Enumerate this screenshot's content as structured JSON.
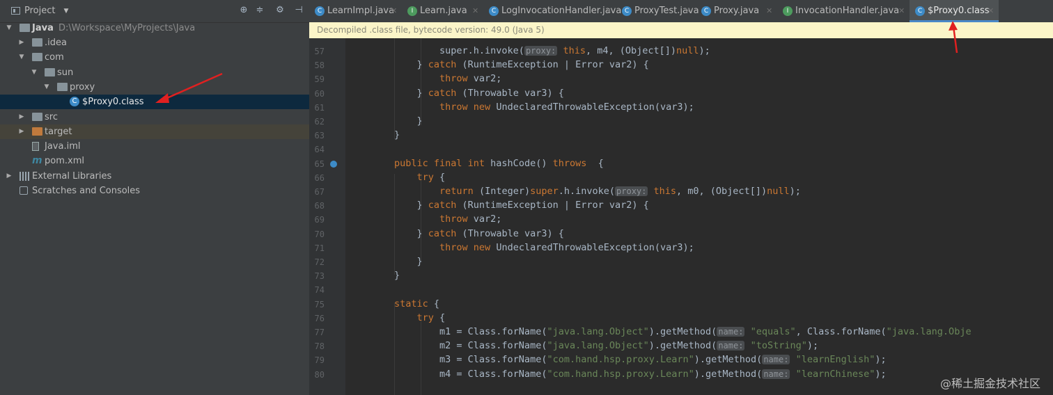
{
  "project_panel": {
    "title": "Project",
    "tree": [
      {
        "label": "Java",
        "path": "D:\\Workspace\\MyProjects\\Java",
        "level": 0,
        "expanded": true,
        "icon": "project-folder-icon"
      },
      {
        "label": ".idea",
        "level": 1,
        "expanded": false,
        "icon": "folder-icon"
      },
      {
        "label": "com",
        "level": 1,
        "expanded": true,
        "icon": "folder-icon"
      },
      {
        "label": "sun",
        "level": 2,
        "expanded": true,
        "icon": "folder-icon"
      },
      {
        "label": "proxy",
        "level": 3,
        "expanded": true,
        "icon": "folder-icon"
      },
      {
        "label": "$Proxy0.class",
        "level": 4,
        "selected": true,
        "icon": "class-file-icon"
      },
      {
        "label": "src",
        "level": 1,
        "expanded": false,
        "icon": "folder-icon"
      },
      {
        "label": "target",
        "level": 1,
        "expanded": false,
        "icon": "excluded-folder-icon"
      },
      {
        "label": "Java.iml",
        "level": 1,
        "icon": "iml-file-icon"
      },
      {
        "label": "pom.xml",
        "level": 1,
        "icon": "maven-icon"
      },
      {
        "label": "External Libraries",
        "level": 0,
        "expanded": false,
        "icon": "library-icon"
      },
      {
        "label": "Scratches and Consoles",
        "level": 0,
        "icon": "scratch-icon"
      }
    ]
  },
  "tabs": [
    {
      "label": "LearnImpl.java",
      "icon": "c"
    },
    {
      "label": "Learn.java",
      "icon": "i"
    },
    {
      "label": "LogInvocationHandler.java",
      "icon": "c"
    },
    {
      "label": "ProxyTest.java",
      "icon": "c"
    },
    {
      "label": "Proxy.java",
      "icon": "c"
    },
    {
      "label": "InvocationHandler.java",
      "icon": "i"
    },
    {
      "label": "$Proxy0.class",
      "icon": "c",
      "active": true
    }
  ],
  "tab_icon_letters": {
    "c": "C",
    "i": "I"
  },
  "banner": "Decompiled .class file, bytecode version: 49.0 (Java 5)",
  "code_lines": [
    {
      "n": "57",
      "html": "        super.h.invoke(<span class=\"hint\">proxy:</span> <span class=\"kw\">this</span>, m4, (Object[])<span class=\"kw\">null</span>);",
      "indent": 0
    },
    {
      "n": "58",
      "html": "    } <span class=\"kw\">catch</span> (RuntimeException | Error var2) {"
    },
    {
      "n": "59",
      "html": "        <span class=\"kw\">throw</span> var2;"
    },
    {
      "n": "60",
      "html": "    } <span class=\"kw\">catch</span> (Throwable var3) {"
    },
    {
      "n": "61",
      "html": "        <span class=\"kw\">throw new</span> UndeclaredThrowableException(var3);"
    },
    {
      "n": "62",
      "html": "    }"
    },
    {
      "n": "63",
      "html": "}"
    },
    {
      "n": "64",
      "html": ""
    },
    {
      "n": "65",
      "html": "<span class=\"kw\">public final int</span> hashCode() <span class=\"kw\">throws</span>  {"
    },
    {
      "n": "66",
      "html": "    <span class=\"kw\">try</span> {"
    },
    {
      "n": "67",
      "html": "        <span class=\"kw\">return</span> (Integer)<span class=\"kw\">super</span>.h.invoke(<span class=\"hint\">proxy:</span> <span class=\"kw\">this</span>, m0, (Object[])<span class=\"kw\">null</span>);"
    },
    {
      "n": "68",
      "html": "    } <span class=\"kw\">catch</span> (RuntimeException | Error var2) {"
    },
    {
      "n": "69",
      "html": "        <span class=\"kw\">throw</span> var2;"
    },
    {
      "n": "70",
      "html": "    } <span class=\"kw\">catch</span> (Throwable var3) {"
    },
    {
      "n": "71",
      "html": "        <span class=\"kw\">throw new</span> UndeclaredThrowableException(var3);"
    },
    {
      "n": "72",
      "html": "    }"
    },
    {
      "n": "73",
      "html": "}"
    },
    {
      "n": "74",
      "html": ""
    },
    {
      "n": "75",
      "html": "<span class=\"kw\">static</span> {"
    },
    {
      "n": "76",
      "html": "    <span class=\"kw\">try</span> {"
    },
    {
      "n": "77",
      "html": "        m1 = Class.forName(<span class=\"st\">\"java.lang.Object\"</span>).getMethod(<span class=\"hint\">name:</span> <span class=\"st\">\"equals\"</span>, Class.forName(<span class=\"st\">\"java.lang.Obje</span>"
    },
    {
      "n": "78",
      "html": "        m2 = Class.forName(<span class=\"st\">\"java.lang.Object\"</span>).getMethod(<span class=\"hint\">name:</span> <span class=\"st\">\"toString\"</span>);"
    },
    {
      "n": "79",
      "html": "        m3 = Class.forName(<span class=\"st\">\"com.hand.hsp.proxy.Learn\"</span>).getMethod(<span class=\"hint\">name:</span> <span class=\"st\">\"learnEnglish\"</span>);"
    },
    {
      "n": "80",
      "html": "        m4 = Class.forName(<span class=\"st\">\"com.hand.hsp.proxy.Learn\"</span>).getMethod(<span class=\"hint\">name:</span> <span class=\"st\">\"learnChinese\"</span>);"
    }
  ],
  "watermark": "@稀土掘金技术社区"
}
